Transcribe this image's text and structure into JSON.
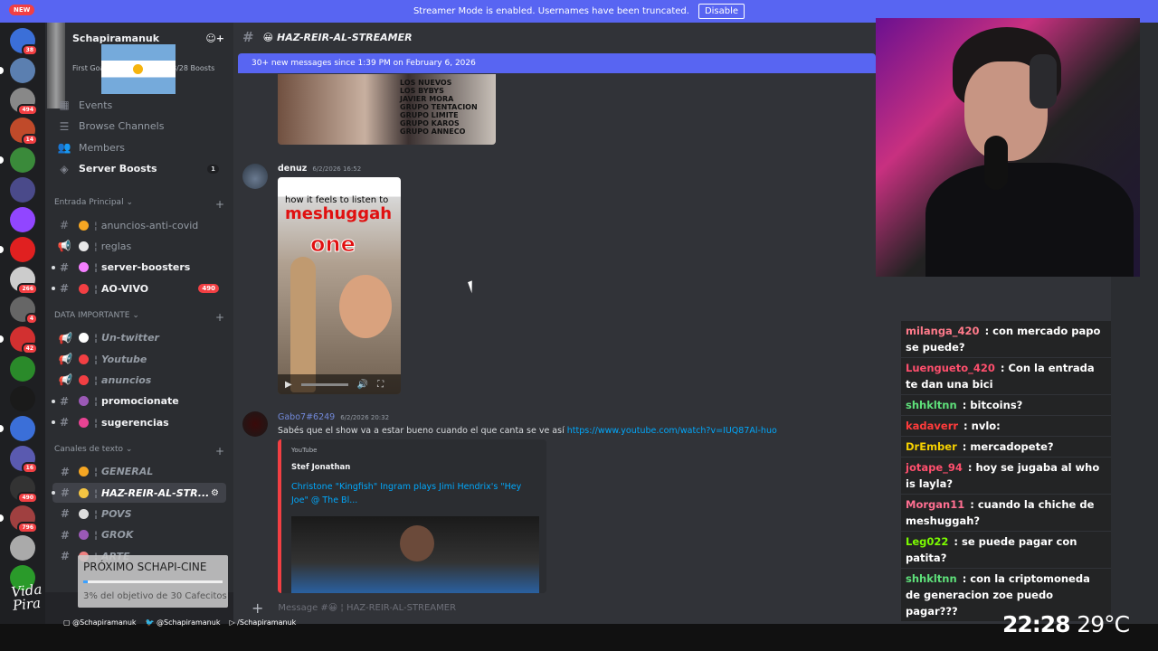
{
  "banner": {
    "text": "Streamer Mode is enabled. Usernames have been truncated.",
    "button": "Disable",
    "new_badge": "NEW"
  },
  "server": {
    "name": "Schapiramanuk",
    "goal_label": "First Goal",
    "boosts_label": "8/28 Boosts"
  },
  "server_badges": [
    "38",
    "",
    "494",
    "14",
    "",
    "",
    "",
    "",
    "266",
    "4",
    "42",
    "",
    "",
    "",
    "16",
    "490",
    "796",
    "",
    ""
  ],
  "sidebar": {
    "top_items": [
      {
        "icon": "calendar-icon",
        "label": "Events"
      },
      {
        "icon": "browse-icon",
        "label": "Browse Channels"
      },
      {
        "icon": "members-icon",
        "label": "Members"
      },
      {
        "icon": "boost-icon",
        "label": "Server Boosts",
        "count": "1"
      }
    ],
    "categories": [
      {
        "name": "Entrada Principal",
        "channels": [
          {
            "label": "anuncios-anti-covid",
            "emoji_color": "#f5a623"
          },
          {
            "label": "reglas",
            "emoji_color": "#e8e8e8"
          },
          {
            "label": "server-boosters",
            "emoji_color": "#f47fff",
            "bold": true
          },
          {
            "label": "AO-VIVO",
            "emoji_color": "#f23f43",
            "bold": true,
            "count": "490"
          }
        ]
      },
      {
        "name": "DATA IMPORTANTE",
        "channels": [
          {
            "label": "Un-twitter",
            "emoji_color": "#ffffff"
          },
          {
            "label": "Youtube",
            "emoji_color": "#f23f43"
          },
          {
            "label": "anuncios",
            "emoji_color": "#f23f43"
          },
          {
            "label": "promocionate",
            "emoji_color": "#9b59b6",
            "bold": true
          },
          {
            "label": "sugerencias",
            "emoji_color": "#e84393",
            "bold": true
          }
        ]
      },
      {
        "name": "Canales de texto",
        "channels": [
          {
            "label": "GENERAL",
            "emoji_color": "#f5a623"
          },
          {
            "label": "HAZ-REIR-AL-STR...",
            "emoji_color": "#f5c542",
            "selected": true
          },
          {
            "label": "POVS",
            "emoji_color": "#dddddd"
          },
          {
            "label": "GROK",
            "emoji_color": "#9b59b6"
          },
          {
            "label": "ARTE",
            "emoji_color": "#f08080"
          }
        ]
      }
    ]
  },
  "goal_widget": {
    "title": "PRÓXIMO SCHAPI-CINE",
    "progress_fraction": 0.03,
    "subtitle": "3% del objetivo de 30 Cafecitos"
  },
  "logo_text": "Vida Pira",
  "channel": {
    "name": "HAZ-REIR-AL-STREAMER",
    "new_messages": "30+ new messages since 1:39 PM on February 6, 2026"
  },
  "image1_text": "LOS NUEVOS\nLOS BYBYS\nJAVIER MORA\nGRUPO TENTACION\nGRUPO LIMITE\nGRUPO KAROS\nGRUPO ANNECO",
  "messages": [
    {
      "author": "denuz",
      "timestamp": "6/2/2026 16:52",
      "video": {
        "caption_top": "how it feels to listen to",
        "caption_band": "meshuggah",
        "caption_word": "one"
      }
    },
    {
      "author": "Gabo7#6249",
      "timestamp": "6/2/2026 20:32",
      "text": "Sabés que el show va a estar bueno cuando el que canta se ve así",
      "link": "https://www.youtube.com/watch?v=IUQ87Al-huo",
      "embed": {
        "provider": "YouTube",
        "author": "Stef Jonathan",
        "title": "Christone \"Kingfish\" Ingram plays Jimi Hendrix's \"Hey Joe\" @ The Bl..."
      }
    }
  ],
  "composer_placeholder": "Message #😀 ¦ HAZ-REIR-AL-STREAMER",
  "read_tag": "ead",
  "stream_chat": [
    {
      "user": "milanga_420",
      "color": "#ff7a8a",
      "text": "con mercado papo se puede?"
    },
    {
      "user": "Luengueto_420",
      "color": "#ff4f6d",
      "text": "Con la entrada te dan una bici"
    },
    {
      "user": "shhkltnn",
      "color": "#5ee07a",
      "text": "bitcoins?"
    },
    {
      "user": "kadaverr",
      "color": "#ff3b3b",
      "text": "nvlo:"
    },
    {
      "user": "DrEmber",
      "color": "#f5d000",
      "text": "mercadopete?"
    },
    {
      "user": "jotape_94",
      "color": "#ff4f6d",
      "text": "hoy se jugaba al who is layla?"
    },
    {
      "user": "Morgan11",
      "color": "#ff6f91",
      "text": "cuando la chiche de meshuggah?"
    },
    {
      "user": "Leg022",
      "color": "#7cfc00",
      "text": "se puede pagar con patita?"
    },
    {
      "user": "shhkltnn",
      "color": "#5ee07a",
      "text": "con la criptomoneda de generacion zoe puedo pagar???"
    }
  ],
  "socials": [
    "@Schapiramanuk",
    "@Schapiramanuk",
    "/Schapiramanuk"
  ],
  "clock": {
    "time": "22:28",
    "temp": "29°C"
  }
}
